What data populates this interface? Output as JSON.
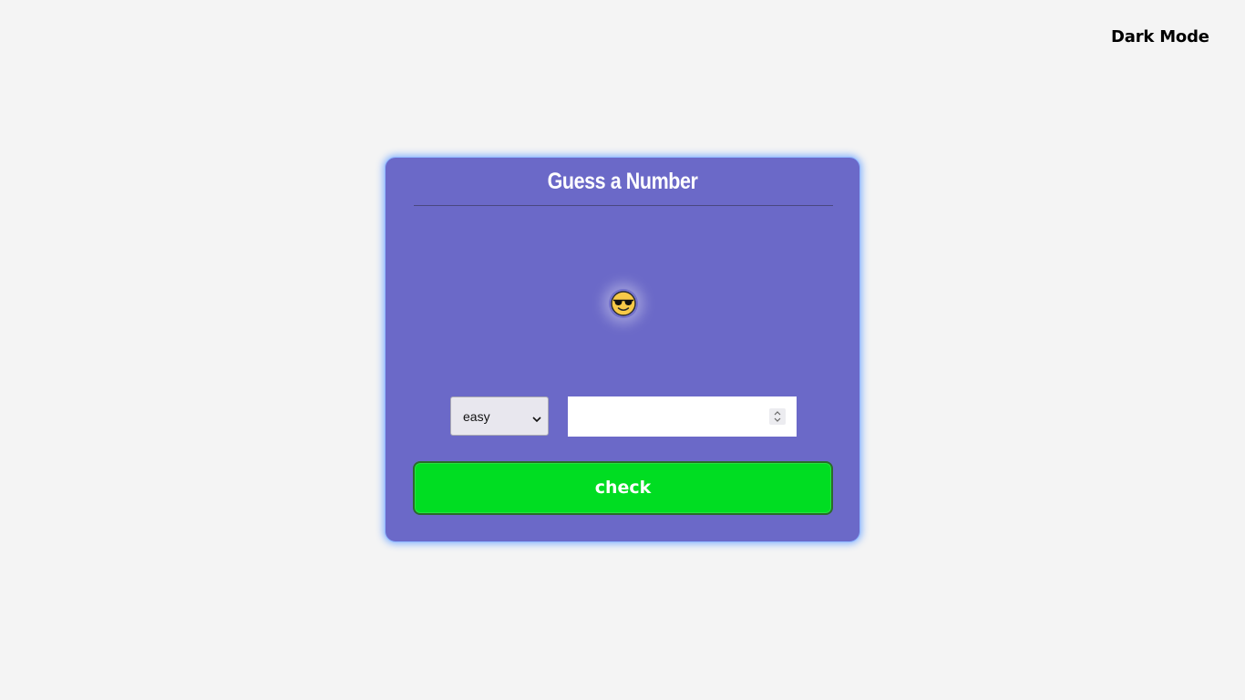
{
  "header": {
    "dark_mode_label": "Dark Mode"
  },
  "game": {
    "title": "Guess a Number",
    "status_icon": "smiling-face-with-sunglasses-icon",
    "difficulty": {
      "selected": "easy"
    },
    "guess_input": {
      "value": ""
    },
    "check_label": "check"
  },
  "colors": {
    "page_background": "#f4f4f4",
    "card_background": "#6b69c8",
    "card_glow": "#8fb6ff",
    "check_button": "#00dd22",
    "text_light": "#ffffff"
  }
}
